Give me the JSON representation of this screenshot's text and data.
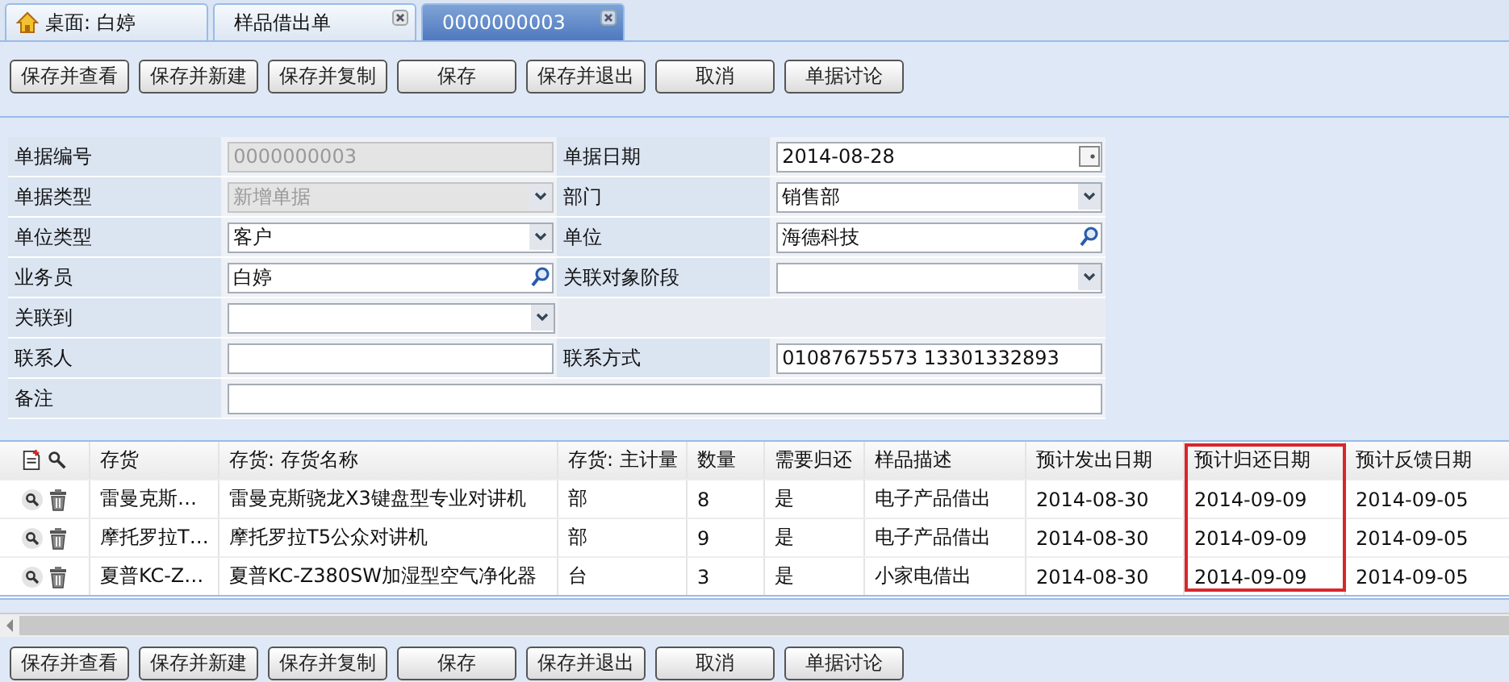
{
  "tabs": [
    {
      "label": "桌面: 白婷",
      "kind": "home",
      "closable": false,
      "selected": false
    },
    {
      "label": "样品借出单",
      "kind": "doc",
      "closable": true,
      "selected": false
    },
    {
      "label": "0000000003",
      "kind": "doc",
      "closable": true,
      "selected": true
    }
  ],
  "toolbar": [
    "保存并查看",
    "保存并新建",
    "保存并复制",
    "保存",
    "保存并退出",
    "取消",
    "单据讨论"
  ],
  "form_rows": [
    [
      {
        "label": "单据编号",
        "kind": "text",
        "value": "0000000003",
        "disabled": true
      },
      {
        "label": "单据日期",
        "kind": "date",
        "value": "2014-08-28",
        "disabled": false
      }
    ],
    [
      {
        "label": "单据类型",
        "kind": "select",
        "value": "新增单据",
        "disabled": true
      },
      {
        "label": "部门",
        "kind": "select",
        "value": "销售部",
        "disabled": false
      }
    ],
    [
      {
        "label": "单位类型",
        "kind": "select",
        "value": "客户",
        "disabled": false
      },
      {
        "label": "单位",
        "kind": "lookup",
        "value": "海德科技",
        "disabled": false
      }
    ],
    [
      {
        "label": "业务员",
        "kind": "lookup",
        "value": "白婷",
        "disabled": false
      },
      {
        "label": "关联对象阶段",
        "kind": "select",
        "disabled": false
      }
    ],
    [
      {
        "label": "关联到",
        "kind": "select",
        "disabled": false
      }
    ],
    [
      {
        "label": "联系人",
        "kind": "text",
        "disabled": false
      },
      {
        "label": "联系方式",
        "kind": "text",
        "value": "01087675573 13301332893",
        "disabled": false
      }
    ],
    [
      {
        "label": "备注",
        "kind": "wide",
        "disabled": false
      }
    ]
  ],
  "table": {
    "columns": [
      {
        "label": "存货",
        "highlighted": false
      },
      {
        "label": "存货: 存货名称",
        "highlighted": false
      },
      {
        "label": "存货: 主计量",
        "highlighted": false
      },
      {
        "label": "数量",
        "highlighted": false
      },
      {
        "label": "需要归还",
        "highlighted": false
      },
      {
        "label": "样品描述",
        "highlighted": false
      },
      {
        "label": "预计发出日期",
        "highlighted": false
      },
      {
        "label": "预计归还日期",
        "highlighted": true
      },
      {
        "label": "预计反馈日期",
        "highlighted": false
      }
    ],
    "rows": [
      [
        "雷曼克斯…",
        "雷曼克斯骁龙X3键盘型专业对讲机",
        "部",
        "8",
        "是",
        "电子产品借出",
        "2014-08-30",
        "2014-09-09",
        "2014-09-05"
      ],
      [
        "摩托罗拉T…",
        "摩托罗拉T5公众对讲机",
        "部",
        "9",
        "是",
        "电子产品借出",
        "2014-08-30",
        "2014-09-09",
        "2014-09-05"
      ],
      [
        "夏普KC-Z…",
        "夏普KC-Z380SW加湿型空气净化器",
        "台",
        "3",
        "是",
        "小家电借出",
        "2014-08-30",
        "2014-09-09",
        "2014-09-05"
      ]
    ]
  },
  "bottom_toolbar": [
    "保存并查看",
    "保存并新建",
    "保存并复制",
    "保存",
    "保存并退出",
    "取消",
    "单据讨论"
  ]
}
